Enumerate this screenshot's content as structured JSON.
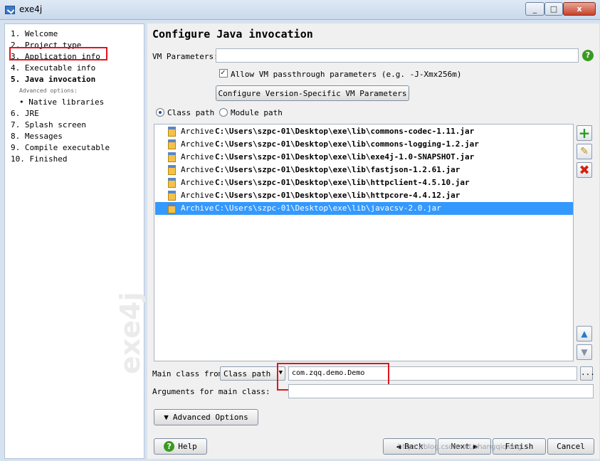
{
  "window": {
    "title": "exe4j",
    "close_glyph": "x",
    "min_glyph": "_",
    "max_glyph": "□"
  },
  "sidebar": {
    "steps": [
      "1. Welcome",
      "2. Project type",
      "3. Application info",
      "4. Executable info",
      "5. Java invocation",
      "Advanced options:",
      "• Native libraries",
      "6. JRE",
      "7. Splash screen",
      "8. Messages",
      "9. Compile executable",
      "10. Finished"
    ],
    "logo": "exe4j"
  },
  "main": {
    "title": "Configure Java invocation",
    "vm_parameters_label": "VM Parameters:",
    "vm_parameters_value": "",
    "allow_passthrough_label": "Allow VM passthrough parameters (e.g. -J-Xmx256m)",
    "configure_version_button": "Configure Version-Specific VM Parameters",
    "class_path_radio": "Class path",
    "module_path_radio": "Module path",
    "classpath_entries": [
      {
        "kind": "Archive",
        "path": "C:\\Users\\szpc-01\\Desktop\\exe\\lib\\commons-codec-1.11.jar"
      },
      {
        "kind": "Archive",
        "path": "C:\\Users\\szpc-01\\Desktop\\exe\\lib\\commons-logging-1.2.jar"
      },
      {
        "kind": "Archive",
        "path": "C:\\Users\\szpc-01\\Desktop\\exe\\lib\\exe4j-1.0-SNAPSHOT.jar"
      },
      {
        "kind": "Archive",
        "path": "C:\\Users\\szpc-01\\Desktop\\exe\\lib\\fastjson-1.2.61.jar"
      },
      {
        "kind": "Archive",
        "path": "C:\\Users\\szpc-01\\Desktop\\exe\\lib\\httpclient-4.5.10.jar"
      },
      {
        "kind": "Archive",
        "path": "C:\\Users\\szpc-01\\Desktop\\exe\\lib\\httpcore-4.4.12.jar"
      },
      {
        "kind": "Archive",
        "path": "C:\\Users\\szpc-01\\Desktop\\exe\\lib\\javacsv-2.0.jar"
      }
    ],
    "main_class_from_label": "Main class from",
    "main_class_source": "Class path",
    "main_class_value": "com.zqq.demo.Demo",
    "browse_button": "...",
    "arguments_label": "Arguments for main class:",
    "arguments_value": "",
    "advanced_options_button": "Advanced Options"
  },
  "footer": {
    "help": "Help",
    "back": "Back",
    "next": "Next",
    "finish": "Finish",
    "cancel": "Cancel",
    "watermark": "https://blog.csdn.net/zhangqiqiang"
  },
  "colors": {
    "selection": "#3399ff",
    "highlight_box": "#e2141c",
    "help_green": "#3a9a20"
  },
  "icons": {
    "add": "add-icon",
    "edit": "edit-icon",
    "remove": "remove-icon",
    "up": "arrow-up-icon",
    "down": "arrow-down-icon"
  }
}
